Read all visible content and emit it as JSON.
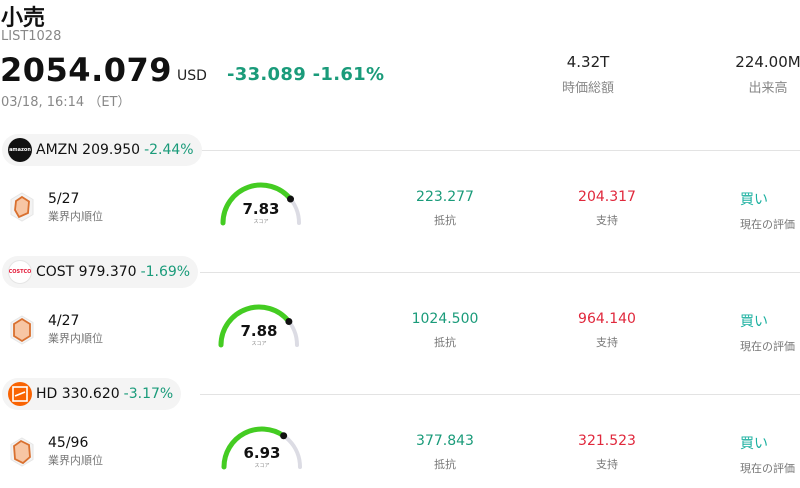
{
  "header": {
    "title": "小売",
    "code": "LIST1028",
    "price": "2054.079",
    "currency": "USD",
    "change": "-33.089 -1.61%",
    "timestamp": "03/18, 16:14 （ET）",
    "market_cap_value": "4.32T",
    "market_cap_label": "時価総額",
    "volume_value": "224.00M",
    "volume_label": "出来高"
  },
  "stocks": [
    {
      "symbol_price": "AMZN 209.950",
      "change": "-2.44%",
      "logo_text": "amazon",
      "rank": "5/27",
      "rank_label": "業界内順位",
      "score": "7.83",
      "score_fraction": 0.783,
      "score_label": "スコア",
      "resistance": "223.277",
      "resistance_label": "抵抗",
      "support": "204.317",
      "support_label": "支持",
      "rating": "買い",
      "rating_label": "現在の評価"
    },
    {
      "symbol_price": "COST 979.370",
      "change": "-1.69%",
      "logo_text": "COSTCO",
      "rank": "4/27",
      "rank_label": "業界内順位",
      "score": "7.88",
      "score_fraction": 0.788,
      "score_label": "スコア",
      "resistance": "1024.500",
      "resistance_label": "抵抗",
      "support": "964.140",
      "support_label": "支持",
      "rating": "買い",
      "rating_label": "現在の評価"
    },
    {
      "symbol_price": "HD 330.620",
      "change": "-3.17%",
      "logo_text": "",
      "rank": "45/96",
      "rank_label": "業界内順位",
      "score": "6.93",
      "score_fraction": 0.693,
      "score_label": "スコア",
      "resistance": "377.843",
      "resistance_label": "抵抗",
      "support": "321.523",
      "support_label": "支持",
      "rating": "買い",
      "rating_label": "現在の評価"
    }
  ],
  "colors": {
    "positive_teal": "#1a9b7a",
    "support_red": "#e0283c",
    "rating_teal": "#1bb0a0",
    "gauge_green": "#44cc22",
    "gauge_track": "#dcdce4",
    "rank_orange": "#d9702f"
  }
}
